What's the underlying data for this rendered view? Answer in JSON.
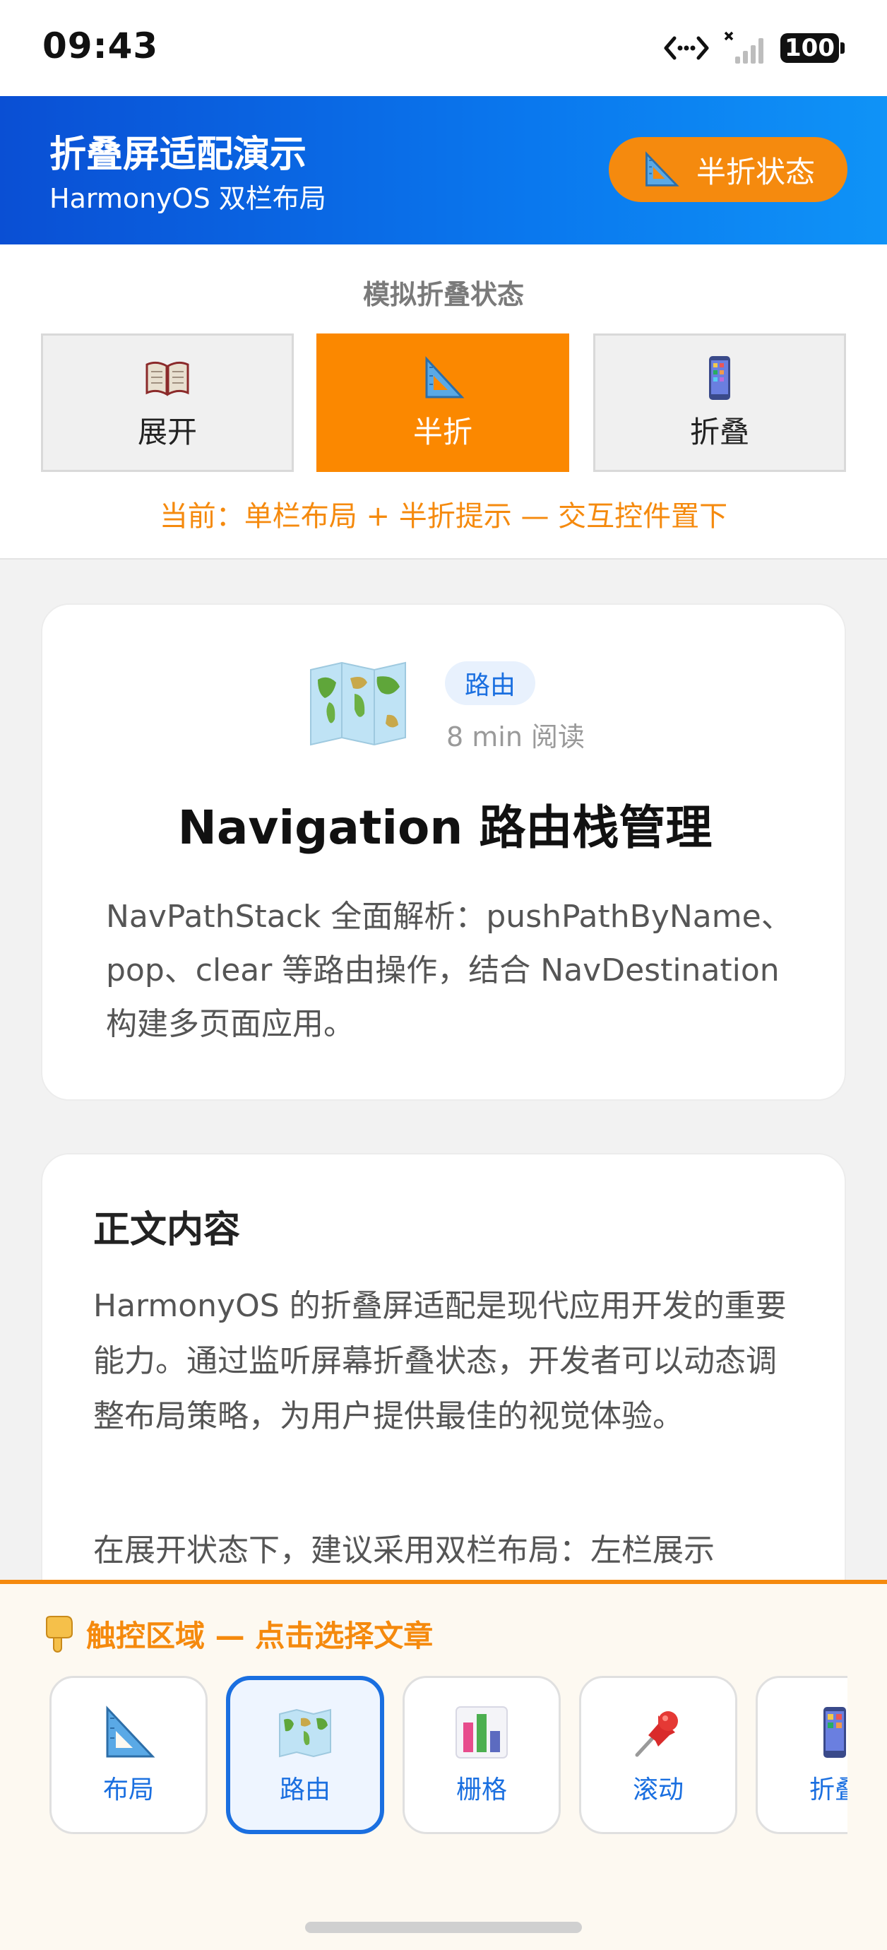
{
  "status_bar": {
    "time": "09:43",
    "battery": "100"
  },
  "header": {
    "title": "折叠屏适配演示",
    "subtitle": "HarmonyOS 双栏布局",
    "state_badge": "半折状态"
  },
  "simulator": {
    "label": "模拟折叠状态",
    "options": [
      {
        "label": "展开",
        "icon": "open-book-icon",
        "active": false
      },
      {
        "label": "半折",
        "icon": "triangle-ruler-icon",
        "active": true
      },
      {
        "label": "折叠",
        "icon": "phone-icon",
        "active": false
      }
    ],
    "current": "当前：单栏布局 + 半折提示 — 交互控件置下"
  },
  "article": {
    "icon": "world-map-icon",
    "tag": "路由",
    "read_time": "8 min 阅读",
    "title": "Navigation 路由栈管理",
    "description": "NavPathStack 全面解析：pushPathByName、pop、clear 等路由操作，结合 NavDestination 构建多页面应用。"
  },
  "body": {
    "heading": "正文内容",
    "paragraph1": "HarmonyOS 的折叠屏适配是现代应用开发的重要能力。通过监听屏幕折叠状态，开发者可以动态调整布局策略，为用户提供最佳的视觉体验。",
    "paragraph2": "在展开状态下，建议采用双栏布局：左栏展示"
  },
  "touch_zone": {
    "title": "触控区域 — 点击选择文章",
    "items": [
      {
        "label": "布局",
        "icon": "triangle-ruler-icon",
        "selected": false
      },
      {
        "label": "路由",
        "icon": "world-map-icon",
        "selected": true
      },
      {
        "label": "栅格",
        "icon": "bar-chart-icon",
        "selected": false
      },
      {
        "label": "滚动",
        "icon": "pushpin-icon",
        "selected": false
      },
      {
        "label": "折叠",
        "icon": "phone-icon",
        "selected": false
      }
    ]
  },
  "colors": {
    "accent_orange": "#f58a0e",
    "brand_blue": "#0a78ee",
    "link_blue": "#1a6fe0"
  }
}
